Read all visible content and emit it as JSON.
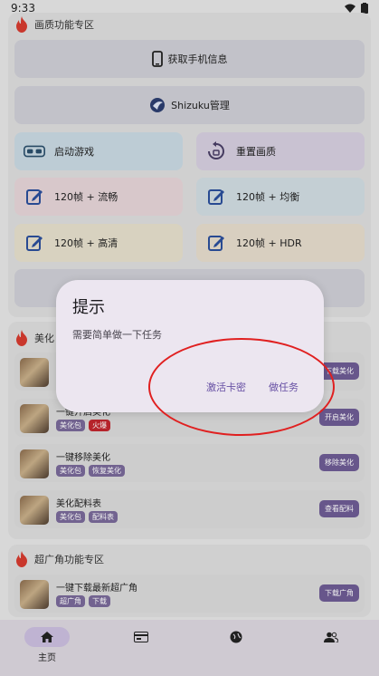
{
  "status_bar": {
    "time": "9:33"
  },
  "section_quality": {
    "title": "画质功能专区",
    "phone_info_label": "获取手机信息",
    "shizuku_label": "Shizuku管理",
    "tiles": [
      {
        "label": "启动游戏",
        "color": "#c9d9e3",
        "icon": "vr-headset-icon"
      },
      {
        "label": "重置画质",
        "color": "#d6cfe0",
        "icon": "reset-icon"
      },
      {
        "label": "120帧 + 流畅",
        "color": "#e6d5d8",
        "icon": "edit-icon"
      },
      {
        "label": "120帧 + 均衡",
        "color": "#d1dce2",
        "icon": "edit-icon"
      },
      {
        "label": "120帧 + 高清",
        "color": "#e6e0cc",
        "icon": "edit-icon"
      },
      {
        "label": "120帧 + HDR",
        "color": "#e6dccc",
        "icon": "edit-icon"
      }
    ]
  },
  "section_beauty": {
    "title": "美化",
    "items": [
      {
        "title": "",
        "tags": [],
        "action": "下载美化"
      },
      {
        "title": "一键开启美化",
        "tags": [
          {
            "label": "美化包",
            "hot": false
          },
          {
            "label": "火爆",
            "hot": true
          }
        ],
        "action": "开启美化"
      },
      {
        "title": "一键移除美化",
        "tags": [
          {
            "label": "美化包",
            "hot": false
          },
          {
            "label": "恢复美化",
            "hot": false
          }
        ],
        "action": "移除美化"
      },
      {
        "title": "美化配料表",
        "tags": [
          {
            "label": "美化包",
            "hot": false
          },
          {
            "label": "配料表",
            "hot": false
          }
        ],
        "action": "查看配料"
      }
    ]
  },
  "section_wide": {
    "title": "超广角功能专区",
    "items": [
      {
        "title": "一键下载最新超广角",
        "tags": [
          {
            "label": "超广角",
            "hot": false
          },
          {
            "label": "下载",
            "hot": false
          }
        ],
        "action": "下载广角"
      }
    ]
  },
  "dialog": {
    "title": "提示",
    "message": "需要简单做一下任务",
    "button_activate": "激活卡密",
    "button_task": "做任务"
  },
  "bottom_nav": {
    "home_label": "主页"
  }
}
